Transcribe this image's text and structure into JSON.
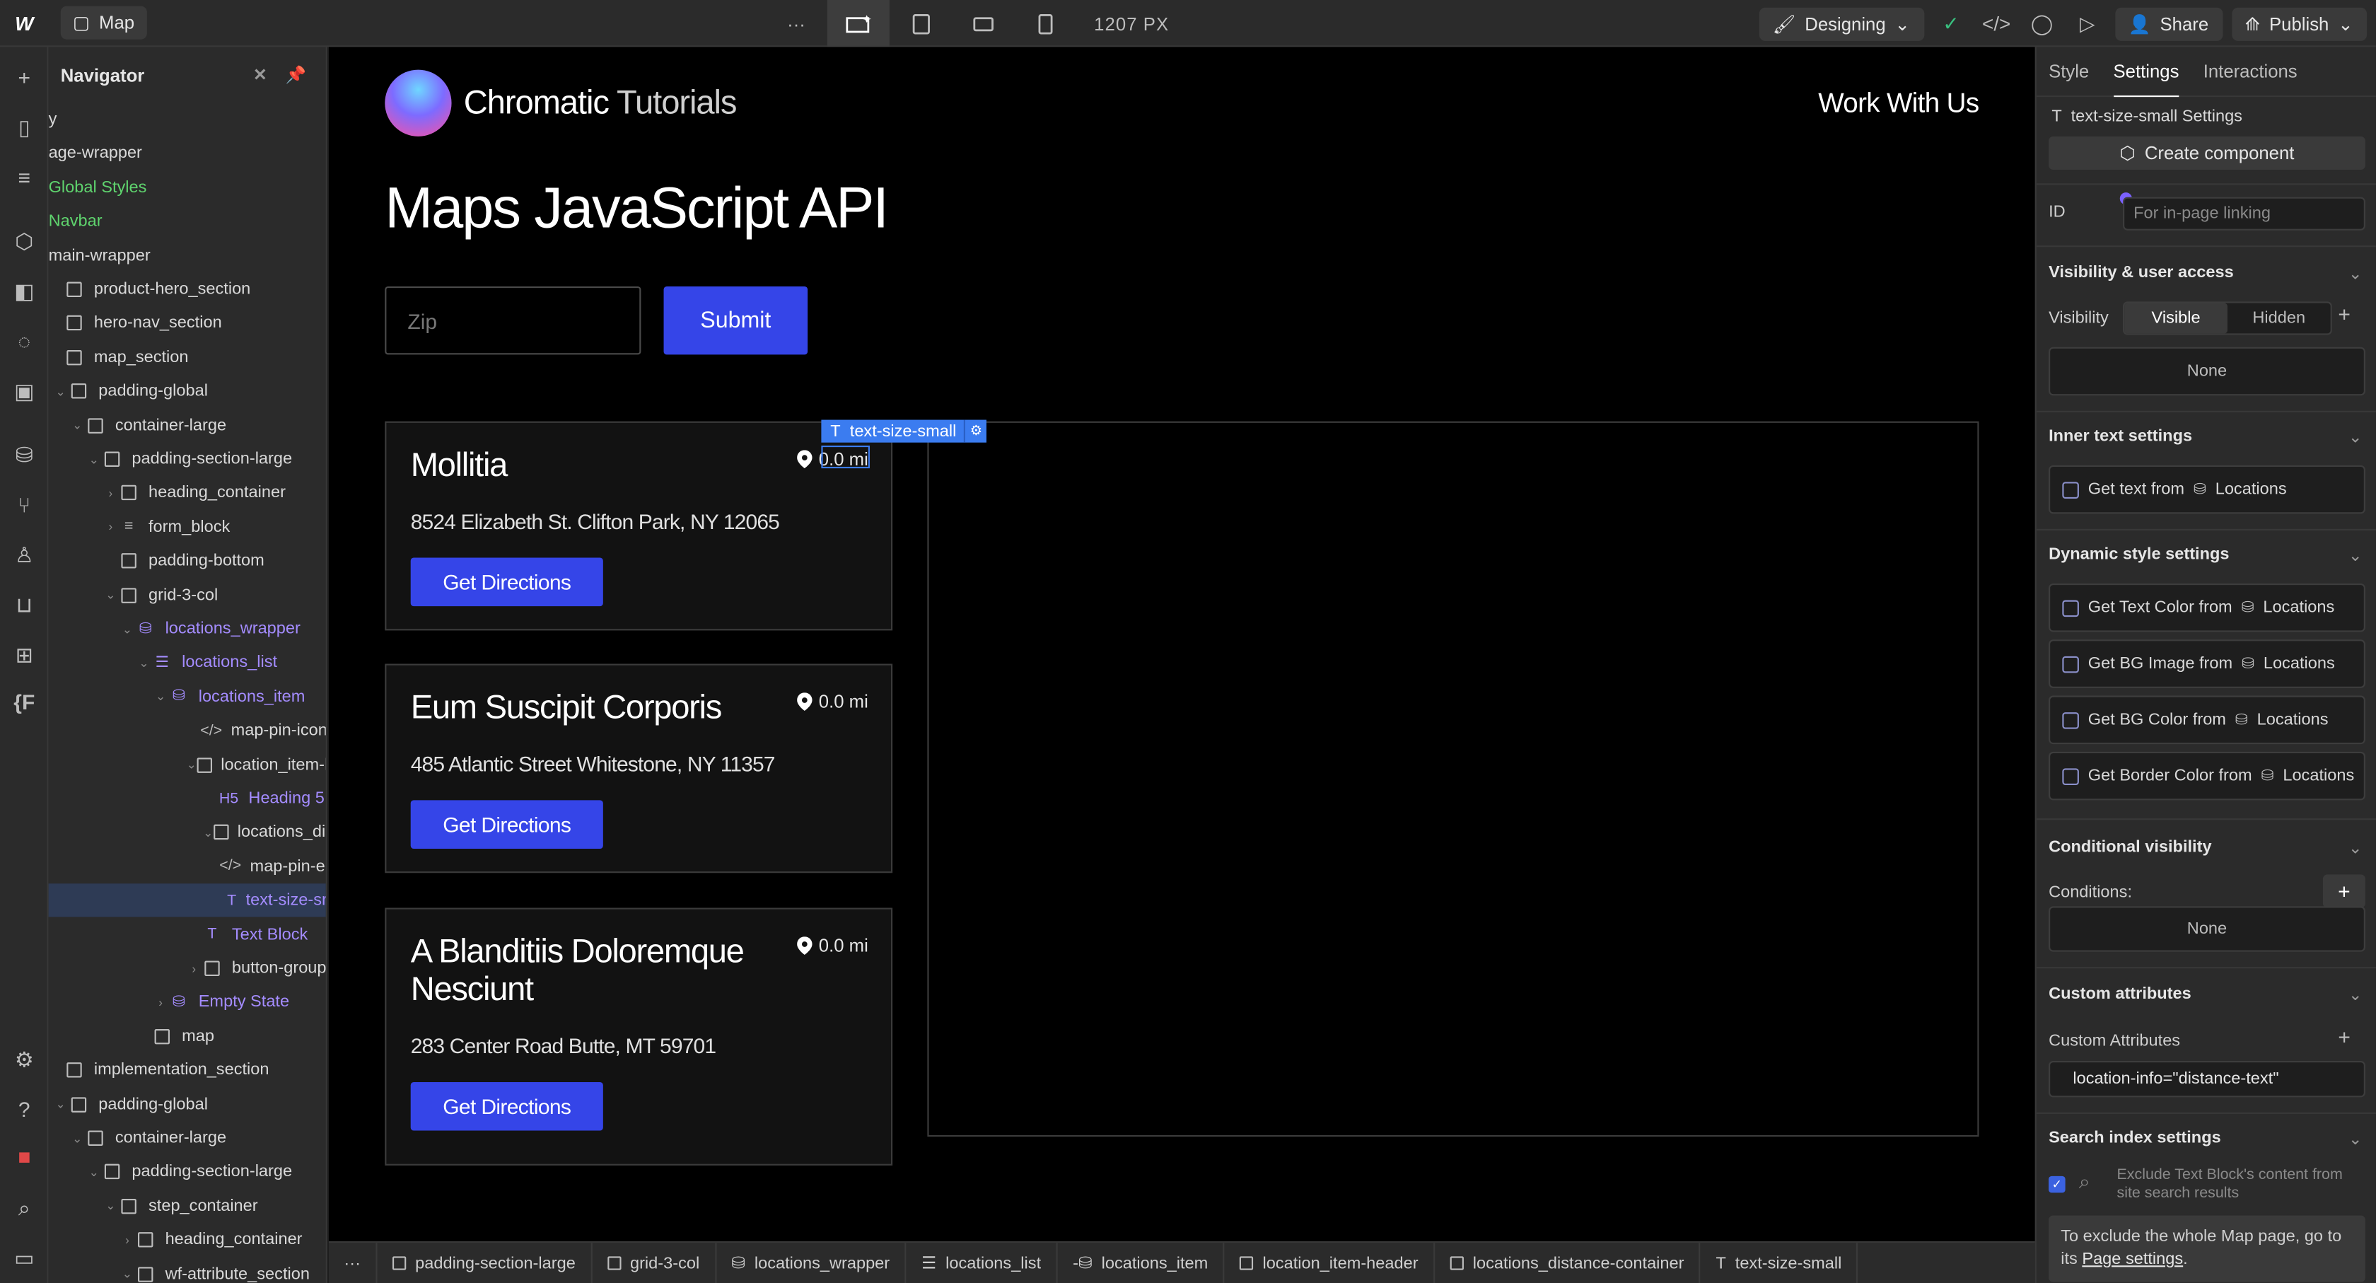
{
  "topbar": {
    "logo": "W",
    "page_name": "Map",
    "more": "···",
    "width_readout": "1207 PX",
    "mode_label": "Designing",
    "share_label": "Share",
    "publish_label": "Publish"
  },
  "navigator": {
    "title": "Navigator",
    "rows": [
      {
        "label": "y"
      },
      {
        "label": "age-wrapper"
      },
      {
        "label": "Global Styles"
      },
      {
        "label": "Navbar"
      },
      {
        "label": "main-wrapper"
      },
      {
        "label": "product-hero_section"
      },
      {
        "label": "hero-nav_section"
      },
      {
        "label": "map_section"
      },
      {
        "label": "padding-global"
      },
      {
        "label": "container-large"
      },
      {
        "label": "padding-section-large"
      },
      {
        "label": "heading_container"
      },
      {
        "label": "form_block"
      },
      {
        "label": "padding-bottom"
      },
      {
        "label": "grid-3-col"
      },
      {
        "label": "locations_wrapper"
      },
      {
        "label": "locations_list"
      },
      {
        "label": "locations_item"
      },
      {
        "label": "map-pin-icon"
      },
      {
        "label": "location_item-he"
      },
      {
        "label": "Heading 5"
      },
      {
        "label": "locations_dist"
      },
      {
        "label": "map-pin-en"
      },
      {
        "label": "text-size-sr"
      },
      {
        "label": "Text Block"
      },
      {
        "label": "button-group"
      },
      {
        "label": "Empty State"
      },
      {
        "label": "map"
      },
      {
        "label": "implementation_section"
      },
      {
        "label": "padding-global"
      },
      {
        "label": "container-large"
      },
      {
        "label": "padding-section-large"
      },
      {
        "label": "step_container"
      },
      {
        "label": "heading_container"
      },
      {
        "label": "wf-attribute_section"
      }
    ]
  },
  "canvas": {
    "brand_bold": "Chromatic",
    "brand_light": "Tutorials",
    "nav_link": "Work With Us",
    "heading": "Maps JavaScript API",
    "zip_placeholder": "Zip",
    "submit_label": "Submit",
    "selection_tag": "text-size-small",
    "cards": [
      {
        "title": "Mollitia",
        "distance": "0.0 mi",
        "address": "8524 Elizabeth St. Clifton Park, NY 12065",
        "button": "Get Directions"
      },
      {
        "title": "Eum Suscipit Corporis",
        "distance": "0.0 mi",
        "address": "485 Atlantic Street Whitestone, NY 11357",
        "button": "Get Directions"
      },
      {
        "title": "A Blanditiis Doloremque Nesciunt",
        "distance": "0.0 mi",
        "address": "283 Center Road Butte, MT 59701",
        "button": "Get Directions"
      }
    ]
  },
  "breadcrumbs": [
    "padding-section-large",
    "grid-3-col",
    "locations_wrapper",
    "locations_list",
    "locations_item",
    "location_item-header",
    "locations_distance-container",
    "text-size-small"
  ],
  "panel": {
    "tabs": [
      "Style",
      "Settings",
      "Interactions"
    ],
    "element_title": "text-size-small Settings",
    "create_component": "Create component",
    "id_label": "ID",
    "id_placeholder": "For in-page linking",
    "visibility_section": "Visibility & user access",
    "visibility_label": "Visibility",
    "visible": "Visible",
    "hidden": "Hidden",
    "none": "None",
    "inner_text_section": "Inner text settings",
    "get_text_from": "Get text from",
    "locations": "Locations",
    "dynamic_section": "Dynamic style settings",
    "dynamic_rows": [
      {
        "label": "Get Text Color from",
        "source": "Locations"
      },
      {
        "label": "Get BG Image from",
        "source": "Locations"
      },
      {
        "label": "Get BG Color from",
        "source": "Locations"
      },
      {
        "label": "Get Border Color from",
        "source": "Locations"
      }
    ],
    "conditional_section": "Conditional visibility",
    "conditions_label": "Conditions:",
    "conditions_none": "None",
    "custom_attr_section": "Custom attributes",
    "custom_attr_label": "Custom Attributes",
    "custom_attr_value": "location-info=\"distance-text\"",
    "search_section": "Search index settings",
    "exclude_text": "Exclude Text Block's content from site search results",
    "note_prefix": "To exclude the whole Map page, go to its",
    "note_link": "Page settings",
    "note_suffix": "."
  },
  "colors": {
    "accent": "#3545e8",
    "selection": "#3b7cf0",
    "canvas_bg": "#000000",
    "ui_bg": "#2b2b2b",
    "green": "#5fd46e",
    "purple": "#a48cff"
  }
}
